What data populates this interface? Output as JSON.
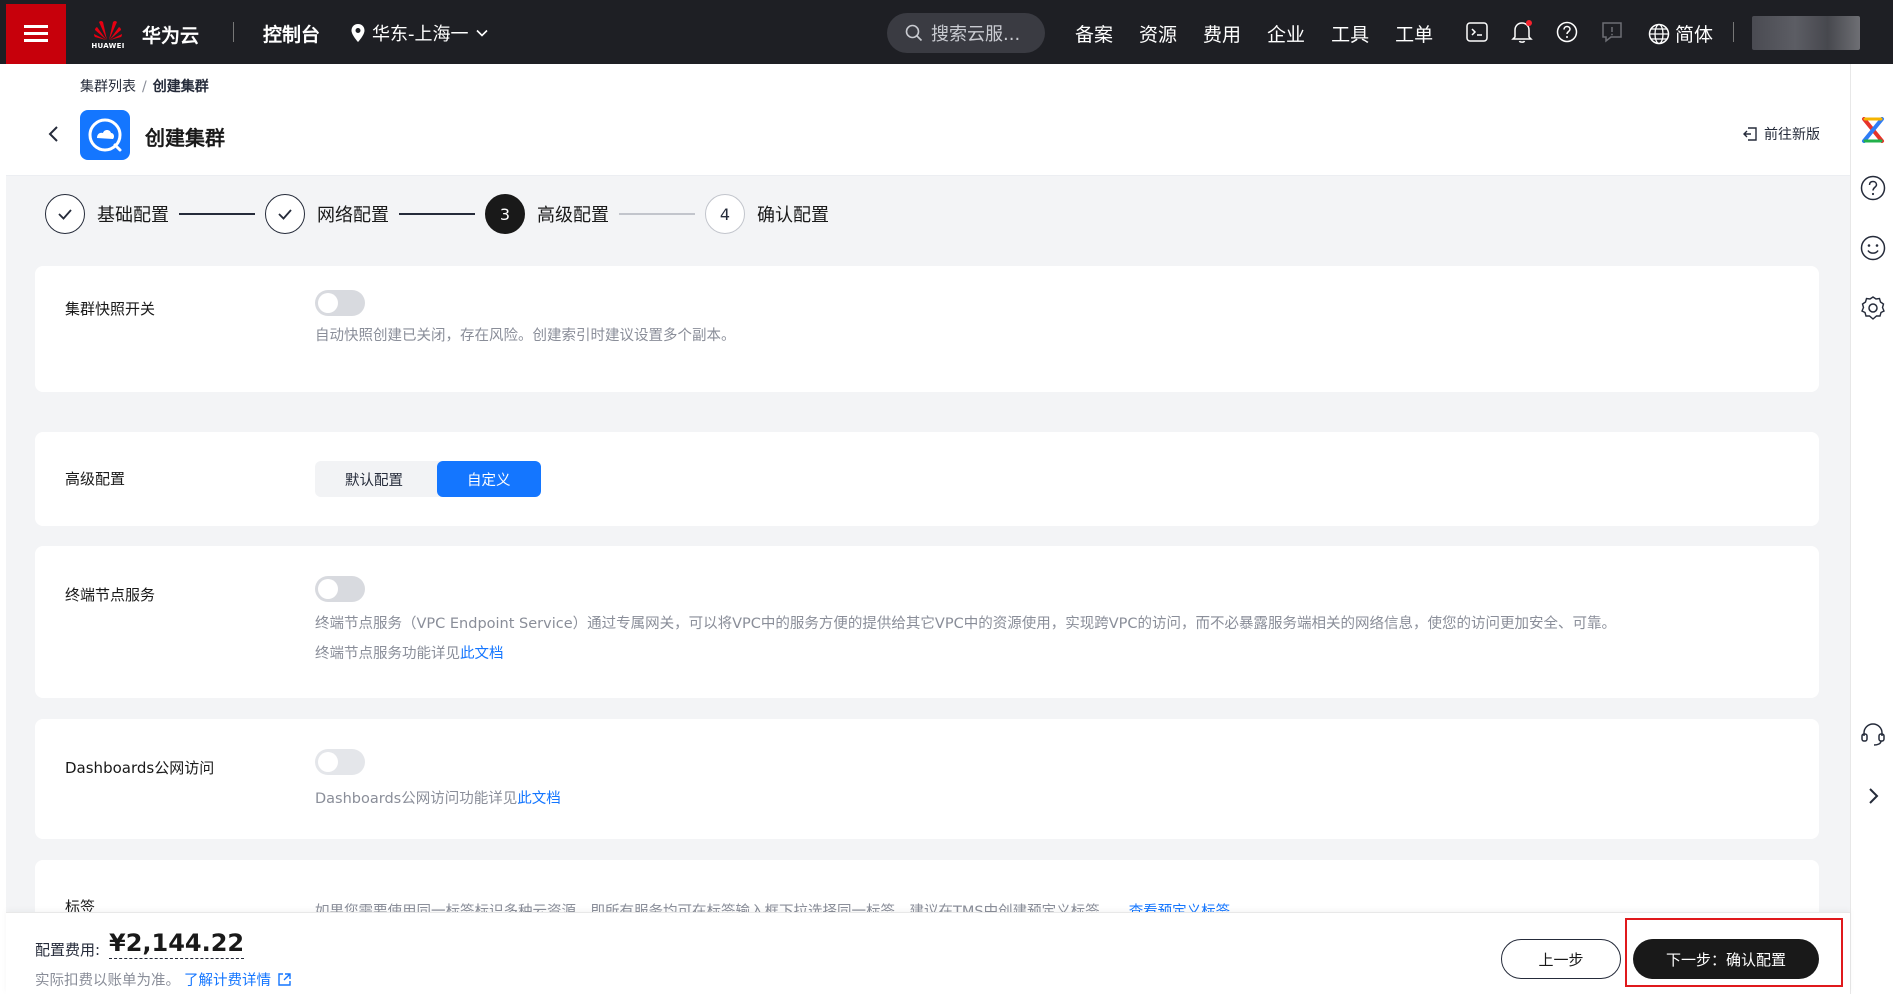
{
  "topbar": {
    "brand_sub": "HUAWEI",
    "brand_name": "华为云",
    "console": "控制台",
    "region": "华东-上海一",
    "search_placeholder": "搜索云服...",
    "nav": [
      "备案",
      "资源",
      "费用",
      "企业",
      "工具",
      "工单"
    ],
    "language": "简体"
  },
  "header": {
    "breadcrumb_parent": "集群列表",
    "breadcrumb_sep": "/",
    "breadcrumb_current": "创建集群",
    "title": "创建集群",
    "new_version": "前往新版"
  },
  "steps": [
    {
      "label": "基础配置",
      "state": "done"
    },
    {
      "label": "网络配置",
      "state": "done"
    },
    {
      "number": "3",
      "label": "高级配置",
      "state": "active"
    },
    {
      "number": "4",
      "label": "确认配置",
      "state": "todo"
    }
  ],
  "sections": {
    "snapshot": {
      "label": "集群快照开关",
      "enabled": false,
      "desc": "自动快照创建已关闭，存在风险。创建索引时建议设置多个副本。"
    },
    "advanced": {
      "label": "高级配置",
      "options": [
        "默认配置",
        "自定义"
      ],
      "selected": "自定义"
    },
    "vpcep": {
      "label": "终端节点服务",
      "enabled": false,
      "desc": "终端节点服务（VPC Endpoint Service）通过专属网关，可以将VPC中的服务方便的提供给其它VPC中的资源使用，实现跨VPC的访问，而不必暴露服务端相关的网络信息，使您的访问更加安全、可靠。",
      "doc_prefix": "终端节点服务功能详见",
      "doc_link": "此文档"
    },
    "dashboards": {
      "label": "Dashboards公网访问",
      "enabled": false,
      "doc_prefix": "Dashboards公网访问功能详见",
      "doc_link": "此文档"
    },
    "tags": {
      "label": "标签",
      "desc": "如果您需要使用同一标签标识多种云资源，即所有服务均可在标签输入框下拉选择同一标签，建议在TMS中创建预定义标签。",
      "link": "查看预定义标签"
    }
  },
  "footer": {
    "fee_label": "配置费用:",
    "fee_value": "¥2,144.22",
    "note": "实际扣费以账单为准。",
    "note_link": "了解计费详情",
    "prev": "上一步",
    "next": "下一步：确认配置"
  },
  "colors": {
    "accent": "#1476ff",
    "topbar": "#1e1f24",
    "menu_red": "#c7000b",
    "highlight": "#e0191c"
  }
}
